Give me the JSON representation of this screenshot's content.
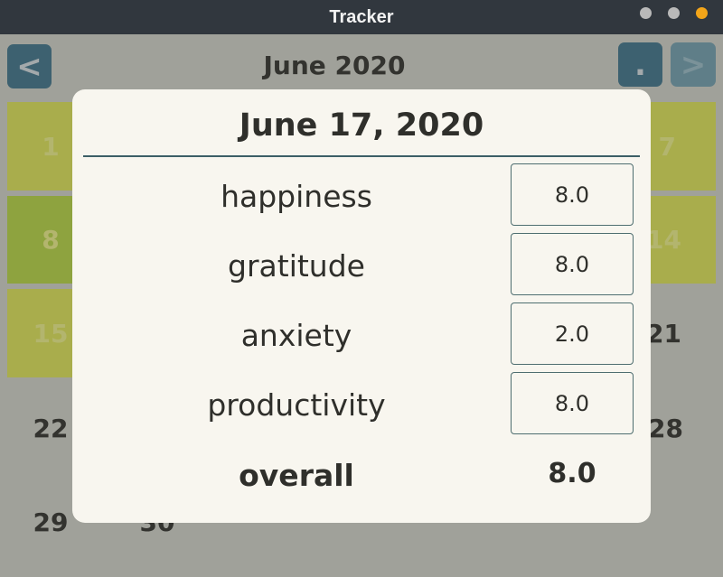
{
  "window": {
    "title": "Tracker"
  },
  "calendar": {
    "month_title": "June 2020",
    "prev_label": "<",
    "today_label": ".",
    "next_label": ">",
    "visible_days": [
      "1",
      "7",
      "8",
      "14",
      "15",
      "21",
      "22",
      "28",
      "29",
      "30"
    ]
  },
  "dialog": {
    "date": "June 17, 2020",
    "rows": [
      {
        "label": "happiness",
        "value": "8.0"
      },
      {
        "label": "gratitude",
        "value": "8.0"
      },
      {
        "label": "anxiety",
        "value": "2.0"
      },
      {
        "label": "productivity",
        "value": "8.0"
      }
    ],
    "overall_label": "overall",
    "overall_value": "8.0"
  }
}
